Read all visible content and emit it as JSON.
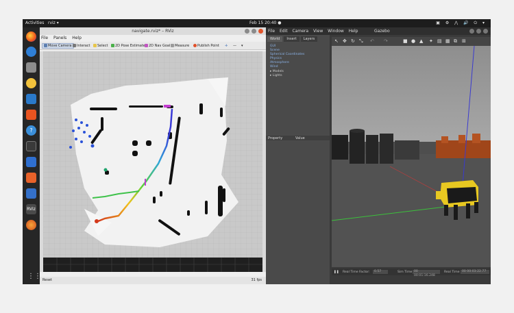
{
  "topbar": {
    "activities": "Activities",
    "app_menu": "rviz ▾",
    "clock": "Feb 15  20:40  ●",
    "tray": "▣ ⚙ ⋀ 🔊 ⏻ ▾"
  },
  "dock": {
    "items": [
      "firefox-icon",
      "thunderbird-icon",
      "files-icon",
      "rhythmbox-icon",
      "writer-icon",
      "software-icon",
      "help-icon",
      "terminal-icon",
      "installer-icon",
      "impress-icon",
      "editor-icon",
      "rviz-icon",
      "gazebo-icon"
    ],
    "rviz_label": "RViz",
    "grid_glyph": "⋮⋮⋮"
  },
  "rviz": {
    "title": "navigate.rviz* – RViz",
    "menu": {
      "file": "File",
      "panels": "Panels",
      "help": "Help"
    },
    "tools": {
      "move_camera": "Move Camera",
      "interact": "Interact",
      "select": "Select",
      "pose_estimate": "2D Pose Estimate",
      "nav_goal": "2D Nav Goal",
      "measure": "Measure",
      "publish_point": "Publish Point",
      "add": "✛",
      "remove": "—",
      "more": "▾"
    },
    "status": {
      "reset": "Reset",
      "fps": "31 fps"
    }
  },
  "gazebo": {
    "title": "Gazebo",
    "menu": {
      "file": "File",
      "edit": "Edit",
      "camera": "Camera",
      "view": "View",
      "window": "Window",
      "help": "Help"
    },
    "tabs": {
      "world": "World",
      "insert": "Insert",
      "layers": "Layers"
    },
    "tree": [
      "GUI",
      "Scene",
      "Spherical Coordinates",
      "Physics",
      "Atmosphere",
      "Wind",
      "▸ Models",
      "▸ Lights"
    ],
    "props": {
      "property": "Property",
      "value": "Value"
    },
    "status": {
      "pause": "❚❚",
      "rtf_label": "Real Time Factor:",
      "rtf": "0.57",
      "sim_label": "Sim Time",
      "sim": "00 00:01:16.248",
      "real_label": "Real Time",
      "real": "00 00:03:22.77"
    },
    "toolbar": [
      "↖",
      "✥",
      "↻",
      "⤡",
      "↶",
      "↷",
      "■",
      "●",
      "▲",
      "✦",
      "▤",
      "▦",
      "⧉",
      "⊞"
    ]
  }
}
